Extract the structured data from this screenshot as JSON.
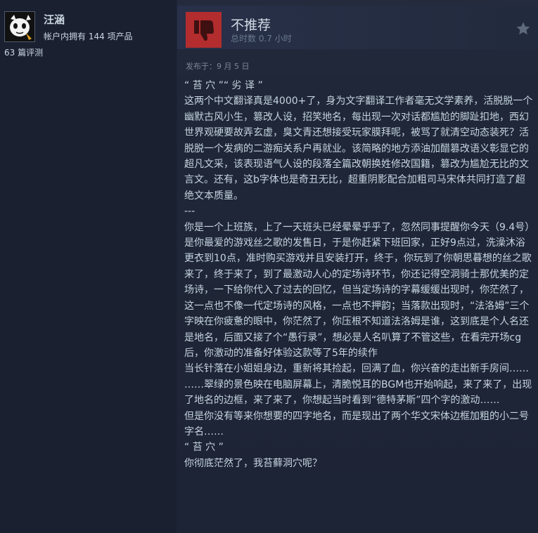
{
  "user": {
    "name": "汪涵",
    "product_count_text": "帐户内拥有 144 项产品",
    "review_count_text": "63 篇评测",
    "avatar_icon": "cartoon-cat-avatar"
  },
  "review": {
    "recommendation": "不推荐",
    "hours_text": "总时数 0.7 小时",
    "thumb_icon": "thumbs-down-icon",
    "thumb_color": "#b32d2f",
    "posted_text": "发布于：9 月 5 日",
    "star_icon": "star-icon",
    "paragraphs": [
      "“ 苔 穴 ”“ 劣 译 ”",
      "这两个中文翻译真是4000+了，身为文字翻译工作者毫无文学素养，活脱脱一个幽默古风小生，篡改人设，招笑地名，每出现一次对话都尴尬的脚趾扣地，西幻世界观硬要故弄玄虚，臭文青还想接受玩家膜拜呢，被骂了就清空动态装死？活脱脱一个发病的二游痴关系户再就业。该简略的地方添油加醋篡改语义彰显它的超凡文采，该表现语气人设的段落全篇改朝换姓修改国籍，篡改为尴尬无比的文言文。还有，这b字体也是奇丑无比，超重阴影配合加粗司马宋体共同打造了超绝文本质量。",
      "---",
      "你是一个上班族，上了一天班头已经晕晕乎乎了，忽然同事提醒你今天（9.4号）是你最爱的游戏丝之歌的发售日，于是你赶紧下班回家，正好9点过，洗澡沐浴更衣到10点，准时购买游戏并且安装打开，终于，你玩到了你朝思暮想的丝之歌",
      "来了，终于来了，到了最激动人心的定场诗环节，你还记得空洞骑士那优美的定场诗，一下给你代入了过去的回忆，但当定场诗的字幕缓缓出现时，你茫然了，这一点也不像一代定场诗的风格，一点也不押韵；当落款出现时，“法洛姆”三个字映在你疲惫的眼中，你茫然了，你压根不知道法洛姆是谁，这到底是个人名还是地名，后面又接了个“愚行录”，想必是人名叭算了不管这些，在看完开场cg后，你激动的准备好体验这款等了5年的续作",
      "当长针落在小姐姐身边，重新将其捡起，回满了血，你兴奋的走出新手房间……",
      "……翠绿的景色映在电脑屏幕上，清脆悦耳的BGM也开始响起，来了来了，出现了地名的边框，来了来了，你想起当时看到“德特茅斯”四个字的激动……",
      "但是你没有等来你想要的四字地名，而是现出了两个华文宋体边框加粗的小二号字名……",
      "“ 苔 穴 ”",
      "你彻底茫然了，我苔藓洞穴呢？"
    ]
  }
}
